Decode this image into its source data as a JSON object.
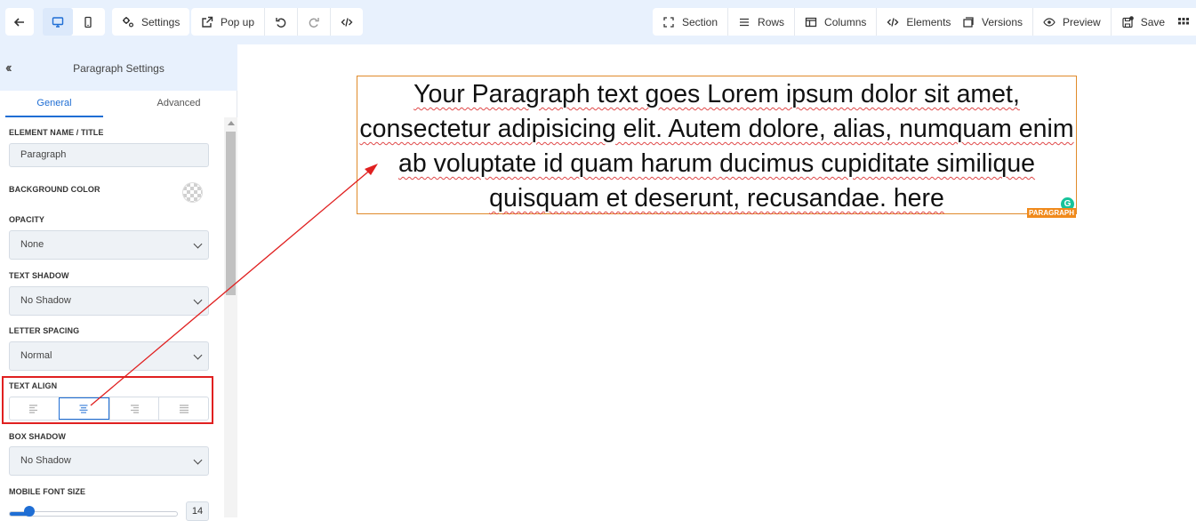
{
  "toolbar": {
    "left": {
      "back_icon": "arrow-left-icon",
      "desktop_icon": "desktop-icon",
      "mobile_icon": "mobile-icon",
      "settings_label": "Settings",
      "popup_label": "Pop up"
    },
    "right": {
      "section_label": "Section",
      "rows_label": "Rows",
      "columns_label": "Columns",
      "elements_label": "Elements",
      "versions_label": "Versions",
      "preview_label": "Preview",
      "save_label": "Save"
    }
  },
  "sidebar": {
    "title": "Paragraph Settings",
    "tabs": [
      {
        "label": "General",
        "active": true
      },
      {
        "label": "Advanced",
        "active": false
      }
    ],
    "fields": {
      "element_name": {
        "label": "ELEMENT NAME / TITLE",
        "value": "Paragraph"
      },
      "background_color": {
        "label": "BACKGROUND COLOR"
      },
      "opacity": {
        "label": "OPACITY",
        "value": "None"
      },
      "text_shadow": {
        "label": "TEXT SHADOW",
        "value": "No Shadow"
      },
      "letter_spacing": {
        "label": "LETTER SPACING",
        "value": "Normal"
      },
      "text_align": {
        "label": "TEXT ALIGN",
        "options": [
          "left",
          "center",
          "right",
          "justify"
        ],
        "selected": "center"
      },
      "box_shadow": {
        "label": "BOX SHADOW",
        "value": "No Shadow"
      },
      "mobile_font_size": {
        "label": "MOBILE FONT SIZE",
        "value": "14",
        "fraction": 0.12
      }
    }
  },
  "canvas": {
    "paragraph_text": "Your Paragraph text goes Lorem ipsum dolor sit amet, consectetur adipisicing elit. Autem dolore, alias, numquam enim ab voluptate id quam harum ducimus cupiditate similique quisquam et deserunt, recusandae. here",
    "element_tag": "PARAGRAPH",
    "grammarly_badge": "G"
  },
  "colors": {
    "toolbar_bg": "#e8f1fd",
    "accent": "#1f6ed4",
    "selection_border": "#e08a2a",
    "annotation_red": "#e02020"
  }
}
